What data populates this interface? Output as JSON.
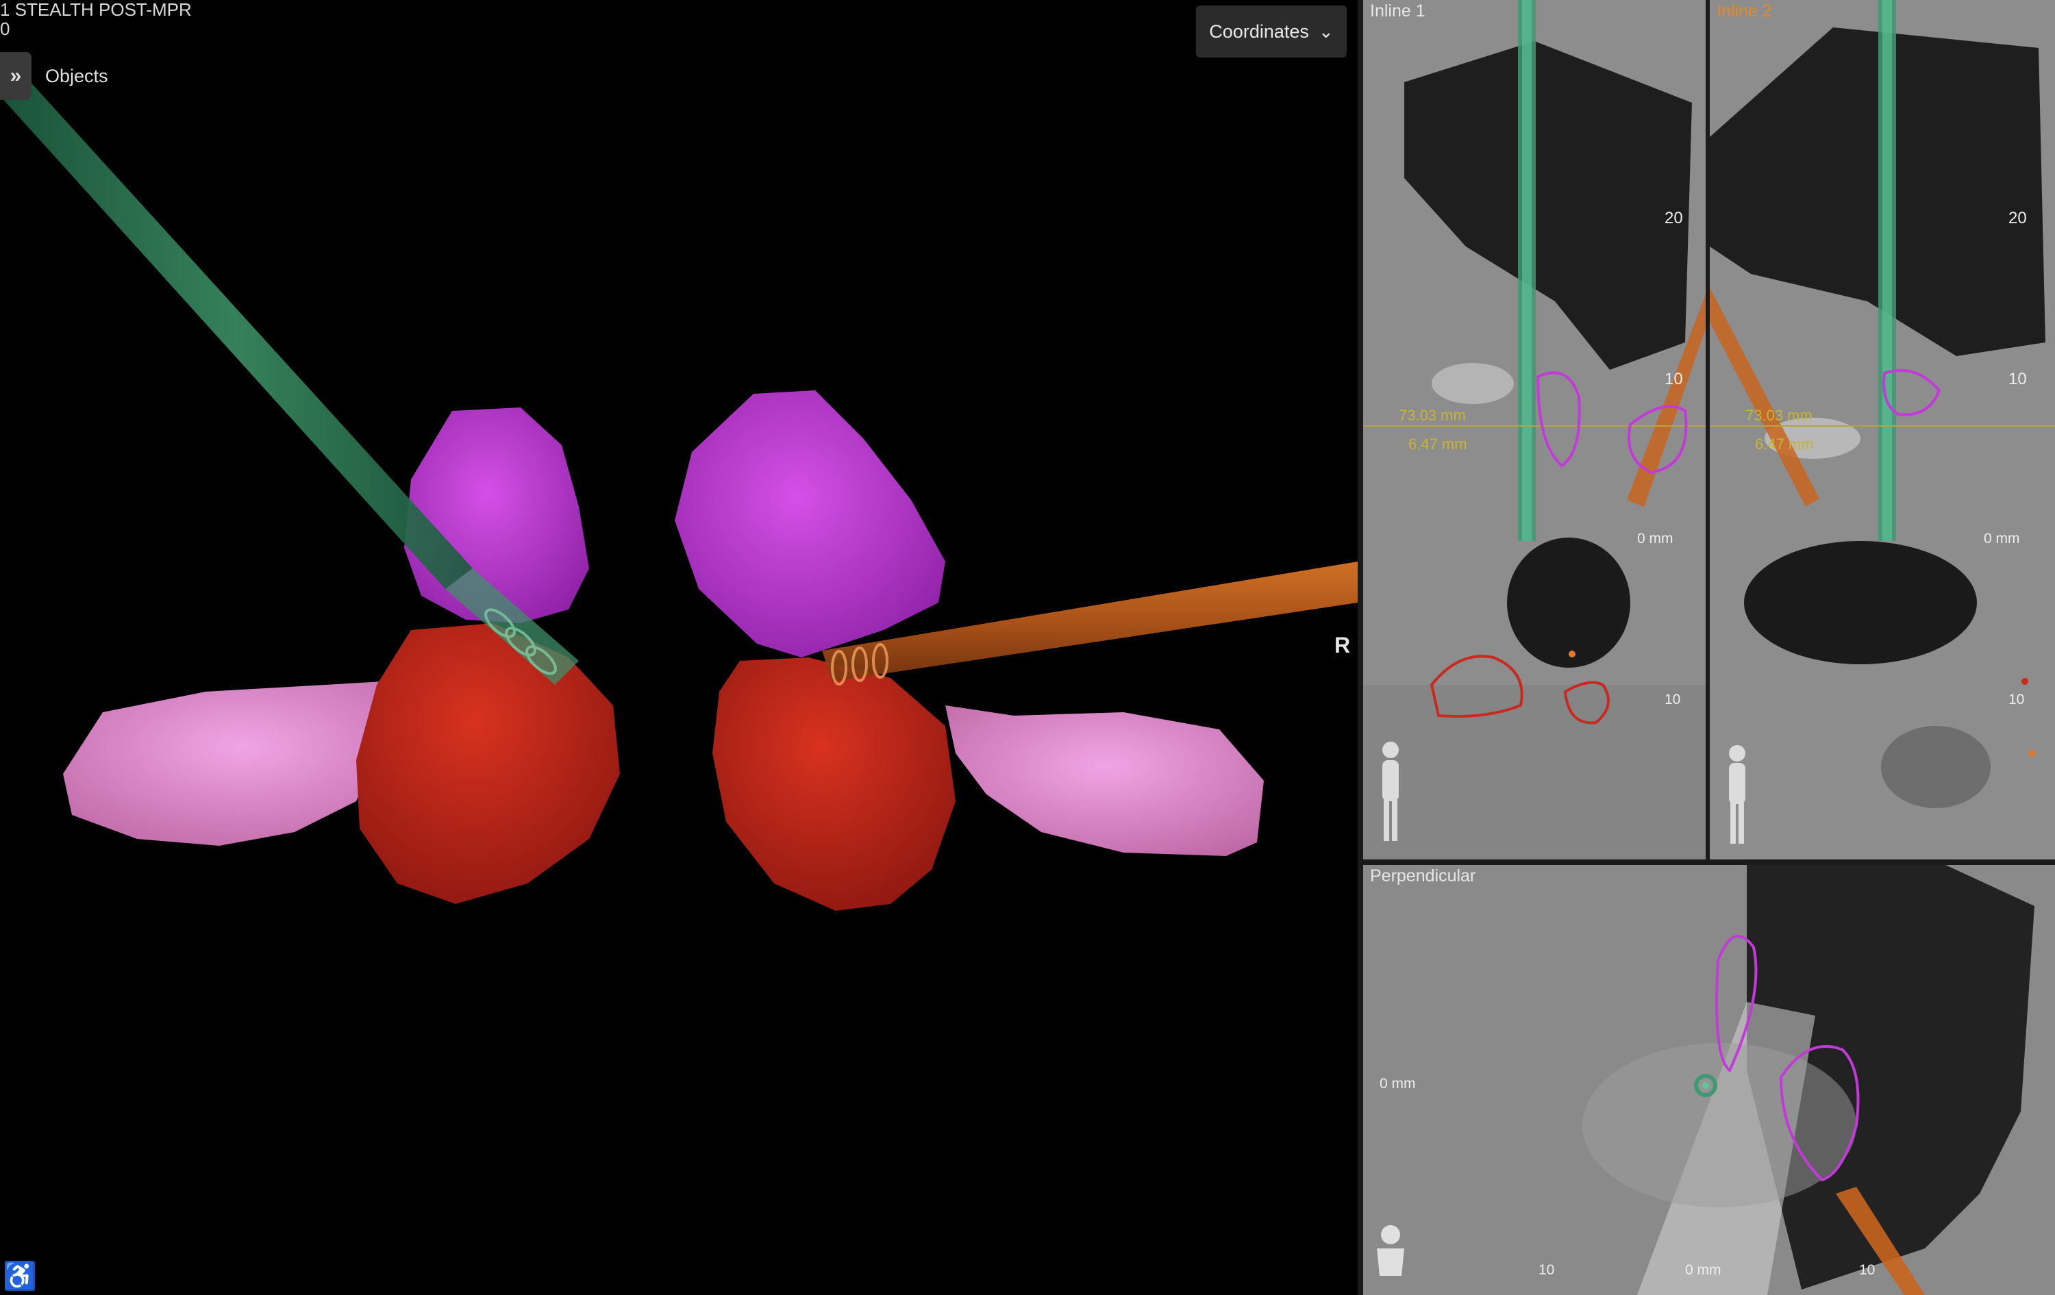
{
  "viewer_3d": {
    "series_title": "1 STEALTH POST-MPR",
    "series_sub": "0",
    "objects_toggle_icon": "double-chevron-right-icon",
    "objects_label": "Objects",
    "coordinates_label": "Coordinates",
    "coordinates_icon": "chevron-down-icon",
    "orientation_label": "R",
    "orientation_widget_icon": "patient-orientation-icon",
    "colors": {
      "trajectory_green": "#2f7a55",
      "trajectory_orange": "#c8651f",
      "structure_magenta": "#c43ad6",
      "structure_red": "#c8281c",
      "structure_pink": "#e58ad6"
    }
  },
  "inline1": {
    "title": "Inline 1",
    "tick_20": "20",
    "tick_10": "10",
    "tick_0": "0 mm",
    "tick_10b": "10",
    "measure_1": "73.03 mm",
    "measure_2": "6.47 mm",
    "title_color": "#e6e6e6"
  },
  "inline2": {
    "title": "Inline 2",
    "tick_20": "20",
    "tick_10": "10",
    "tick_0": "0 mm",
    "tick_10b": "10",
    "measure_1": "73.03 mm",
    "measure_2": "6.47 mm",
    "title_color": "#e08a2a"
  },
  "perpendicular": {
    "title": "Perpendicular",
    "tick_left": "0 mm",
    "tick_b1": "10",
    "tick_b2": "0 mm",
    "tick_b3": "10"
  }
}
